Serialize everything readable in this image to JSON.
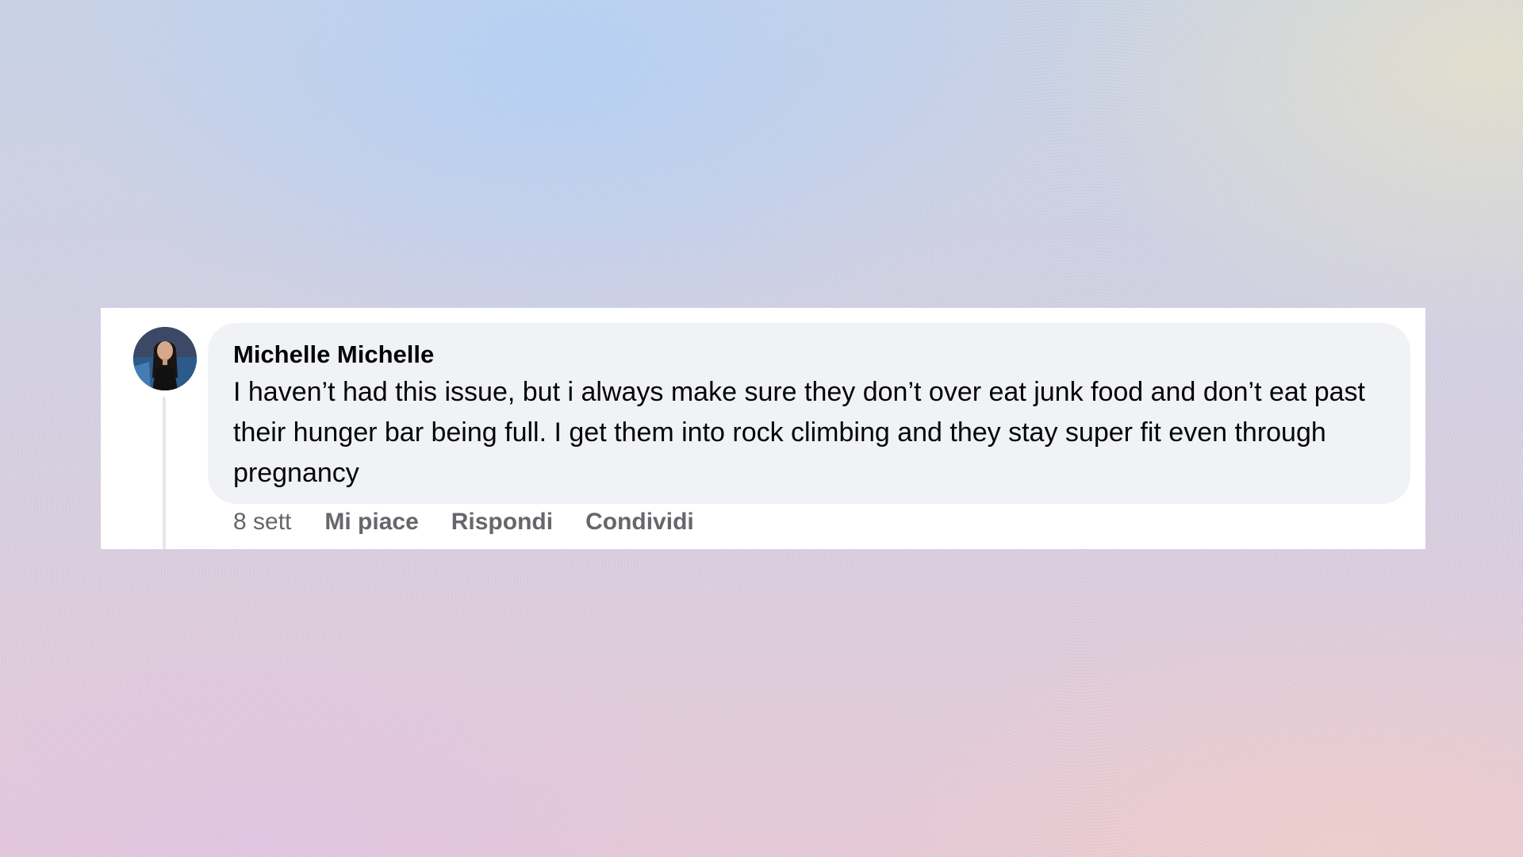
{
  "comment": {
    "author": "Michelle Michelle",
    "text": "I haven’t had this issue, but i always make sure they don’t over eat junk food and don’t eat past their hunger bar being full. I get them into rock climbing and they stay super fit even through pregnancy",
    "time": "8 sett",
    "actions": {
      "like": "Mi piace",
      "reply": "Rispondi",
      "share": "Condividi"
    }
  },
  "colors": {
    "bubble": "#f0f2f5",
    "text": "#050505",
    "meta": "#65676b"
  }
}
